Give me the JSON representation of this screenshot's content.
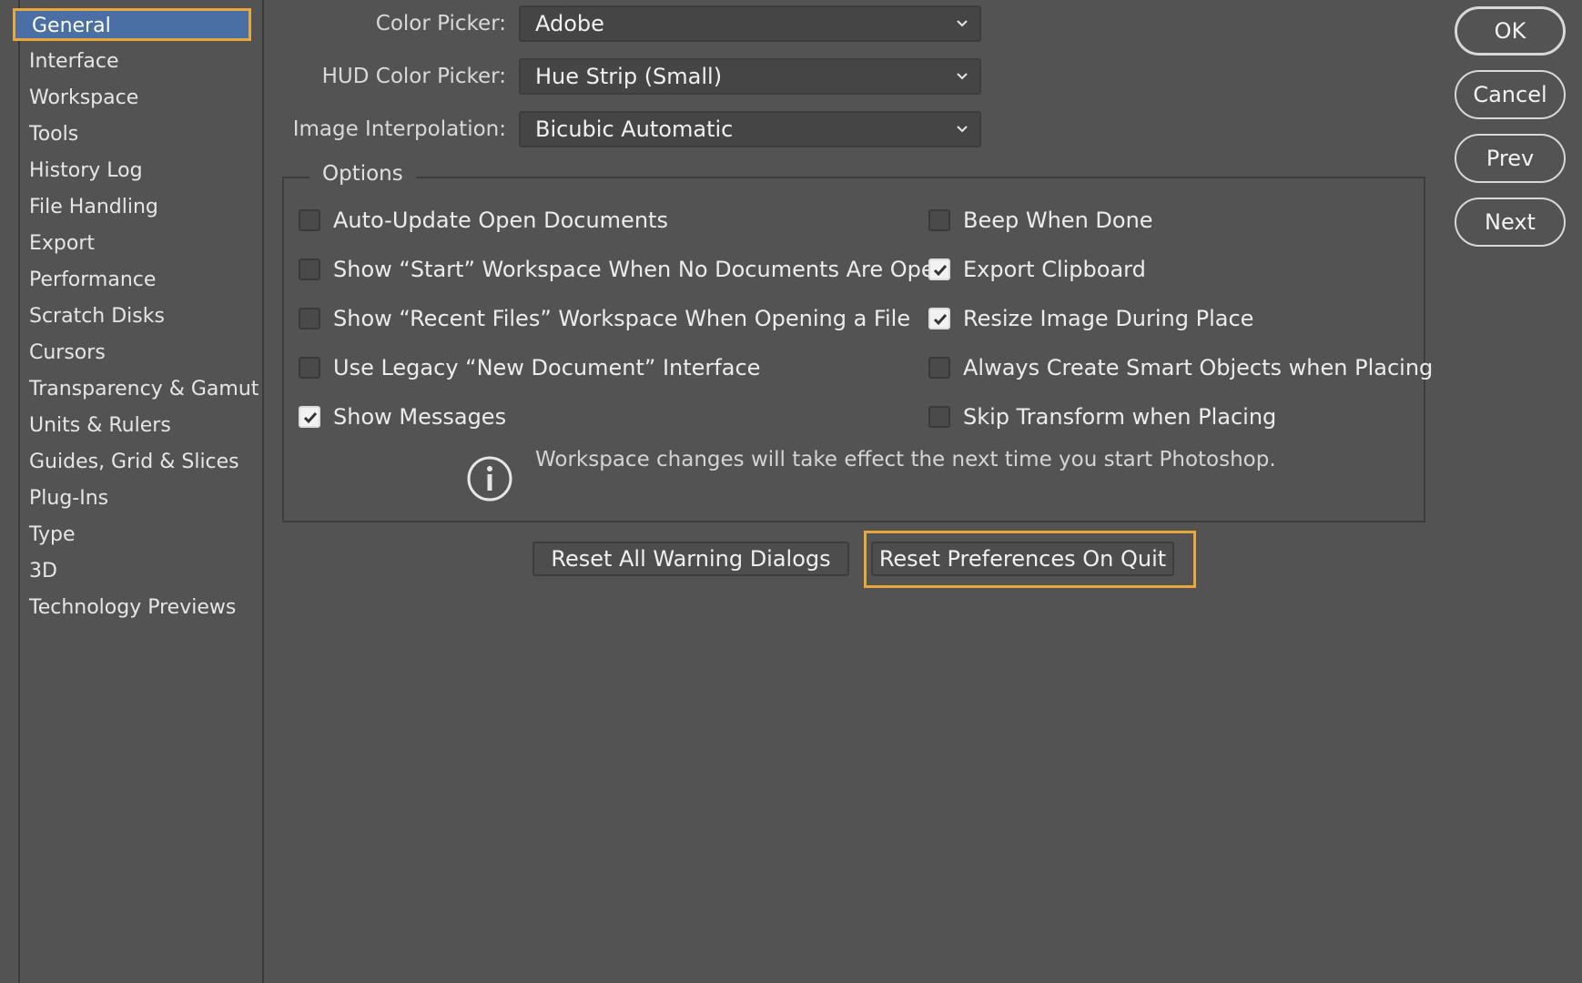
{
  "sidebar": {
    "items": [
      {
        "label": "General",
        "selected": true
      },
      {
        "label": "Interface"
      },
      {
        "label": "Workspace"
      },
      {
        "label": "Tools"
      },
      {
        "label": "History Log"
      },
      {
        "label": "File Handling"
      },
      {
        "label": "Export"
      },
      {
        "label": "Performance"
      },
      {
        "label": "Scratch Disks"
      },
      {
        "label": "Cursors"
      },
      {
        "label": "Transparency & Gamut"
      },
      {
        "label": "Units & Rulers"
      },
      {
        "label": "Guides, Grid & Slices"
      },
      {
        "label": "Plug-Ins"
      },
      {
        "label": "Type"
      },
      {
        "label": "3D"
      },
      {
        "label": "Technology Previews"
      }
    ]
  },
  "form": {
    "color_picker": {
      "label": "Color Picker:",
      "value": "Adobe"
    },
    "hud_color_picker": {
      "label": "HUD Color Picker:",
      "value": "Hue Strip (Small)"
    },
    "image_interpolation": {
      "label": "Image Interpolation:",
      "value": "Bicubic Automatic"
    }
  },
  "options": {
    "legend": "Options",
    "left": [
      {
        "label": "Auto-Update Open Documents",
        "checked": false
      },
      {
        "label": "Show “Start” Workspace When No Documents Are Open",
        "checked": false
      },
      {
        "label": "Show “Recent Files” Workspace When Opening a File",
        "checked": false
      },
      {
        "label": "Use Legacy “New Document” Interface",
        "checked": false
      },
      {
        "label": "Show Messages",
        "checked": true
      }
    ],
    "right": [
      {
        "label": "Beep When Done",
        "checked": false
      },
      {
        "label": "Export Clipboard",
        "checked": true
      },
      {
        "label": "Resize Image During Place",
        "checked": true
      },
      {
        "label": "Always Create Smart Objects when Placing",
        "checked": false
      },
      {
        "label": "Skip Transform when Placing",
        "checked": false
      }
    ],
    "info": "Workspace changes will take effect the next time you start Photoshop."
  },
  "actions": {
    "reset_warnings": "Reset All Warning Dialogs",
    "reset_prefs": "Reset Preferences On Quit"
  },
  "dialog_buttons": {
    "ok": "OK",
    "cancel": "Cancel",
    "prev": "Prev",
    "next": "Next"
  },
  "colors": {
    "background": "#535353",
    "focus": "#e8a73a",
    "selection": "#4a6fa5"
  }
}
